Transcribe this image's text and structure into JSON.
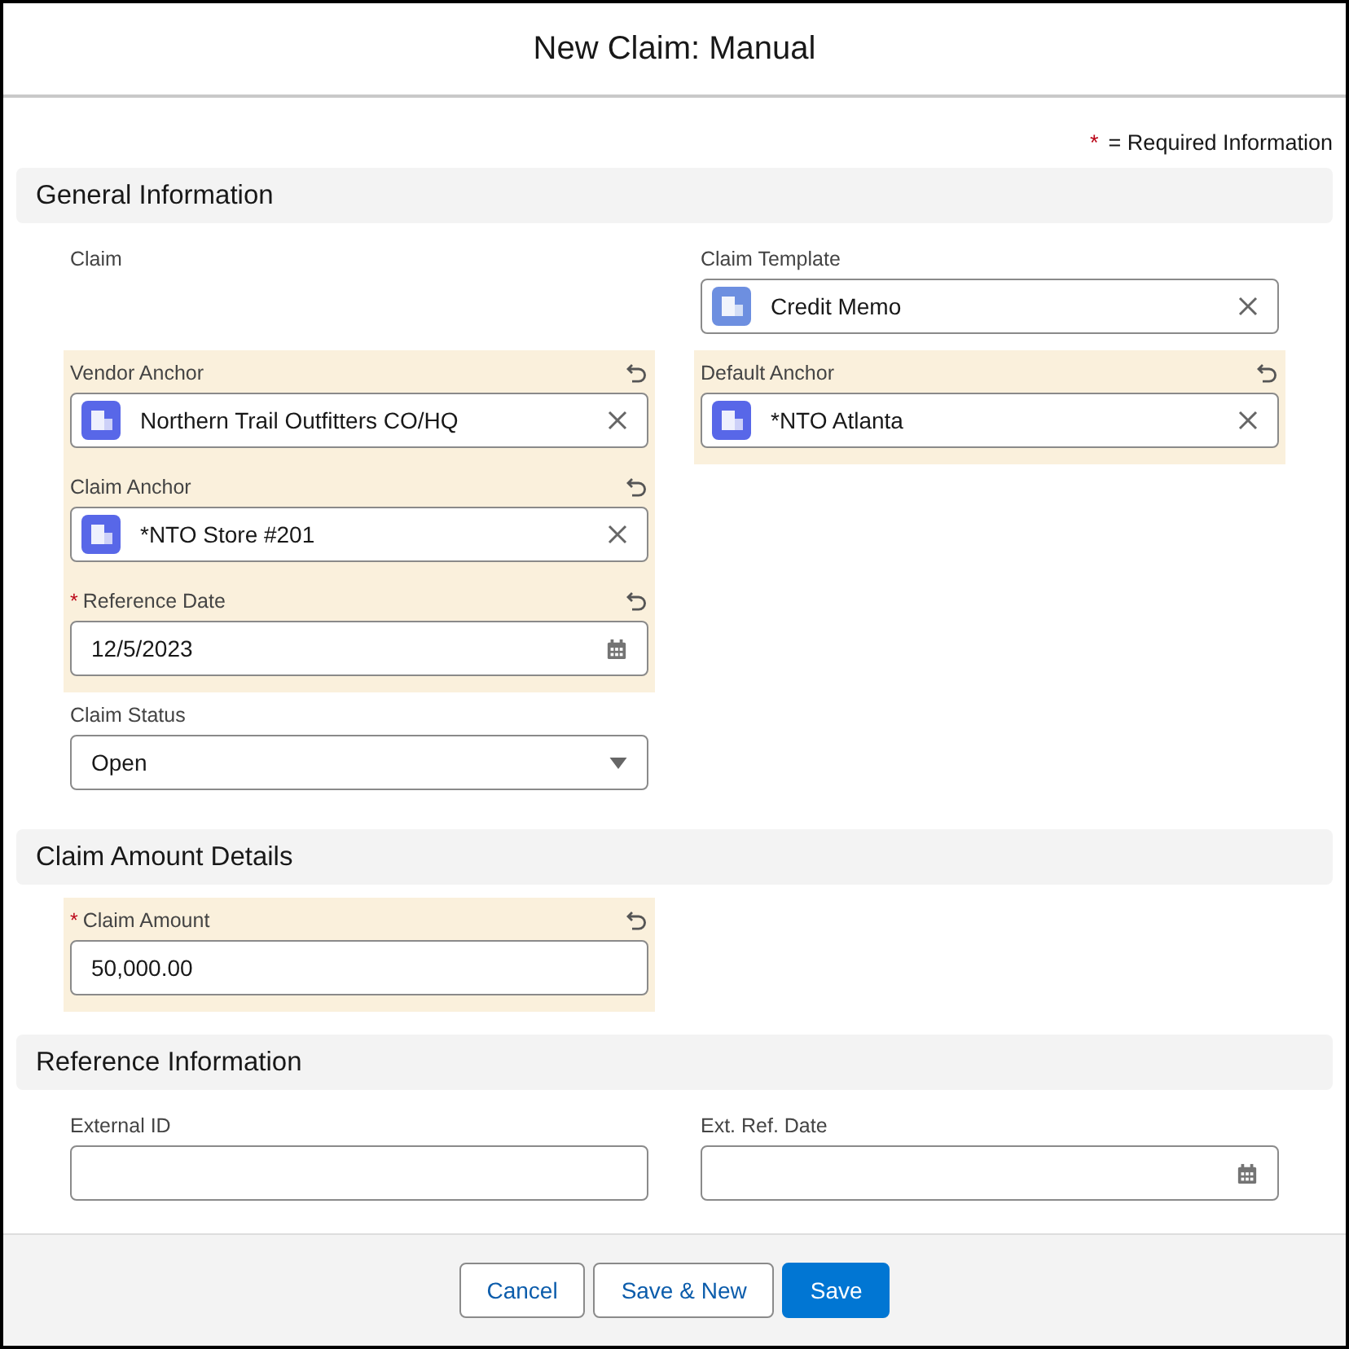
{
  "window": {
    "title": "New Claim: Manual"
  },
  "legend": {
    "mark": "*",
    "text": "= Required Information"
  },
  "sections": [
    {
      "title": "General Information",
      "rows": [
        [
          {
            "label": "Claim",
            "kind": "output",
            "required": false,
            "changed": false
          },
          {
            "label": "Claim Template",
            "kind": "lookup",
            "value": "Credit Memo",
            "color": "#6d8fe0",
            "required": false,
            "changed": false
          }
        ],
        [
          {
            "label": "Vendor Anchor",
            "kind": "lookup",
            "value": "Northern Trail Outfitters CO/HQ",
            "color": "#5867e8",
            "required": false,
            "changed": true
          },
          {
            "label": "Default Anchor",
            "kind": "lookup",
            "value": "*NTO Atlanta",
            "color": "#5867e8",
            "required": false,
            "changed": true
          }
        ],
        [
          {
            "label": "Claim Anchor",
            "kind": "lookup",
            "value": "*NTO Store #201",
            "color": "#5867e8",
            "required": false,
            "changed": true
          }
        ],
        [
          {
            "label": "Reference Date",
            "kind": "date",
            "value": "12/5/2023",
            "required": true,
            "changed": true
          }
        ],
        [
          {
            "label": "Claim Status",
            "kind": "picklist",
            "value": "Open",
            "required": false,
            "changed": false
          }
        ]
      ]
    },
    {
      "title": "Claim Amount Details",
      "rows": [
        [
          {
            "label": "Claim Amount",
            "kind": "text",
            "value": "50,000.00",
            "required": true,
            "changed": true
          }
        ]
      ]
    },
    {
      "title": "Reference Information",
      "rows": [
        [
          {
            "label": "External ID",
            "kind": "text",
            "required": false,
            "changed": false
          },
          {
            "label": "Ext. Ref. Date",
            "kind": "date",
            "required": false,
            "changed": false
          }
        ]
      ]
    }
  ],
  "buttons": [
    {
      "label": "Cancel",
      "kind": "neutral"
    },
    {
      "label": "Save & New",
      "kind": "neutral"
    },
    {
      "label": "Save",
      "kind": "brand"
    }
  ]
}
